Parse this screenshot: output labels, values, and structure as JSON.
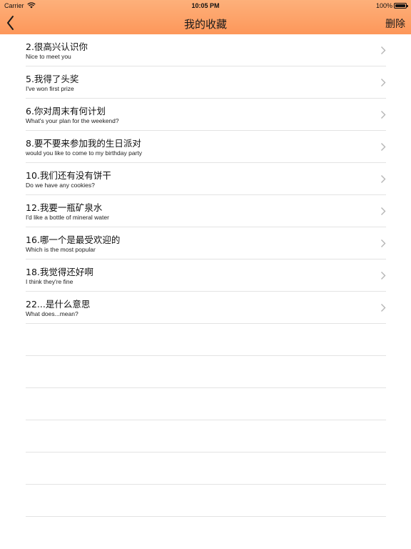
{
  "status_bar": {
    "carrier": "Carrier",
    "time": "10:05 PM",
    "battery": "100%"
  },
  "nav": {
    "title": "我的收藏",
    "delete_label": "删除"
  },
  "colors": {
    "header_top": "#fdb07a",
    "header_bottom": "#fd975a",
    "separator": "#e3e3e3",
    "chevron": "#b5b5b5"
  },
  "favorites": [
    {
      "zh": "2.很高兴认识你",
      "en": "Nice to meet you"
    },
    {
      "zh": "5.我得了头奖",
      "en": "I've won first prize"
    },
    {
      "zh": "6.你对周末有何计划",
      "en": "What's your plan for the weekend?"
    },
    {
      "zh": "8.要不要来参加我的生日派对",
      "en": "would you like to come to my birthday party"
    },
    {
      "zh": "10.我们还有没有饼干",
      "en": "Do we have any cookies?"
    },
    {
      "zh": "12.我要一瓶矿泉水",
      "en": "I'd like a bottle of mineral water"
    },
    {
      "zh": "16.哪一个是最受欢迎的",
      "en": "Which is the most popular"
    },
    {
      "zh": "18.我觉得还好啊",
      "en": "I think they're fine"
    },
    {
      "zh": "22...是什么意思",
      "en": "What does...mean?"
    }
  ]
}
